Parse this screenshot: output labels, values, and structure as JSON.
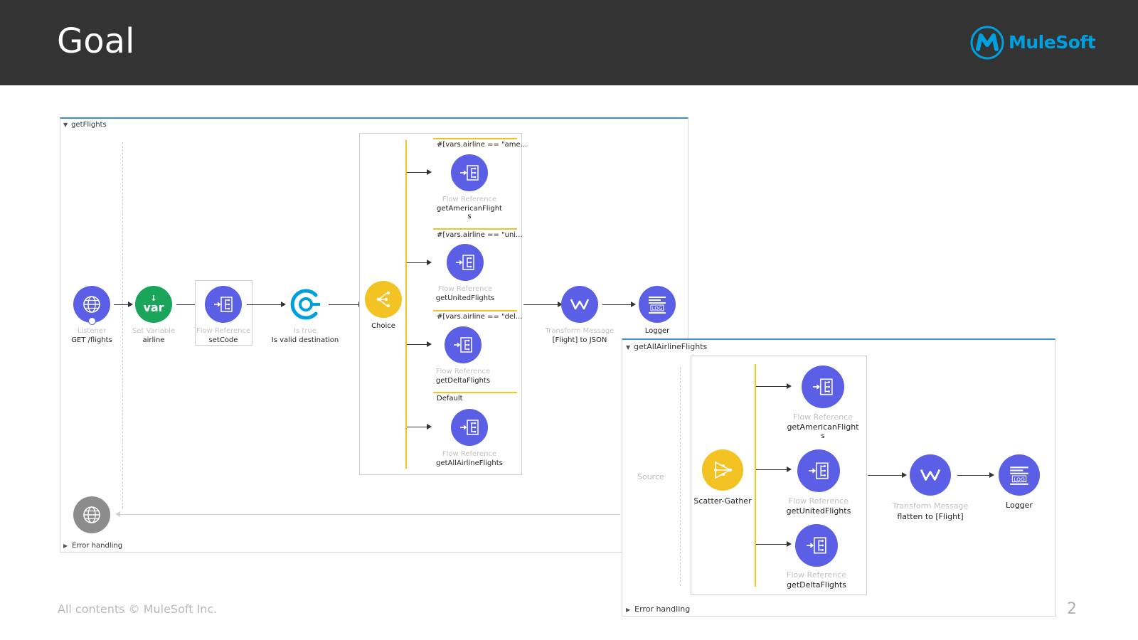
{
  "slide": {
    "title": "Goal",
    "brand": "MuleSoft",
    "footer": "All contents © MuleSoft Inc.",
    "page_number": "2"
  },
  "colors": {
    "header_bg": "#333333",
    "processor": "#5b5fe6",
    "variable": "#1aa55a",
    "router": "#f3c323",
    "validation": "#00a0df",
    "panel_border": "#3a8ad5"
  },
  "get_flights": {
    "title": "getFlights",
    "error_handling": "Error handling",
    "listener": {
      "type": "Listener",
      "name": "GET /flights",
      "icon": "globe-icon"
    },
    "set_variable": {
      "type": "Set Variable",
      "name": "airline",
      "icon": "var-icon",
      "icon_text": "var"
    },
    "flow_ref": {
      "type": "Flow Reference",
      "name": "setCode",
      "icon": "flow-reference-icon"
    },
    "validation": {
      "type": "Is true",
      "name": "Is valid destination",
      "icon": "validation-icon"
    },
    "choice": {
      "name": "Choice",
      "icon": "choice-router-icon"
    },
    "routes": [
      {
        "condition": "#[vars.airline == \"ame...",
        "type": "Flow Reference",
        "name": "getAmericanFlight",
        "name_cont": "s"
      },
      {
        "condition": "#[vars.airline == \"uni...",
        "type": "Flow Reference",
        "name": "getUnitedFlights"
      },
      {
        "condition": "#[vars.airline == \"del...",
        "type": "Flow Reference",
        "name": "getDeltaFlights"
      },
      {
        "condition": "Default",
        "type": "Flow Reference",
        "name": "getAllAirlineFlights"
      }
    ],
    "transform": {
      "type": "Transform Message",
      "name": "[Flight] to JSON",
      "icon": "dataweave-icon"
    },
    "logger": {
      "name": "Logger",
      "icon": "logger-icon",
      "icon_text": "LOG"
    }
  },
  "get_all_airline_flights": {
    "title": "getAllAirlineFlights",
    "source_label": "Source",
    "error_handling": "Error handling",
    "scatter": {
      "name": "Scatter-Gather",
      "icon": "scatter-gather-icon"
    },
    "routes": [
      {
        "type": "Flow Reference",
        "name": "getAmericanFlight",
        "name_cont": "s"
      },
      {
        "type": "Flow Reference",
        "name": "getUnitedFlights"
      },
      {
        "type": "Flow Reference",
        "name": "getDeltaFlights"
      }
    ],
    "transform": {
      "type": "Transform Message",
      "name": "flatten to [Flight]",
      "icon": "dataweave-icon"
    },
    "logger": {
      "name": "Logger",
      "icon": "logger-icon",
      "icon_text": "LOG"
    }
  }
}
